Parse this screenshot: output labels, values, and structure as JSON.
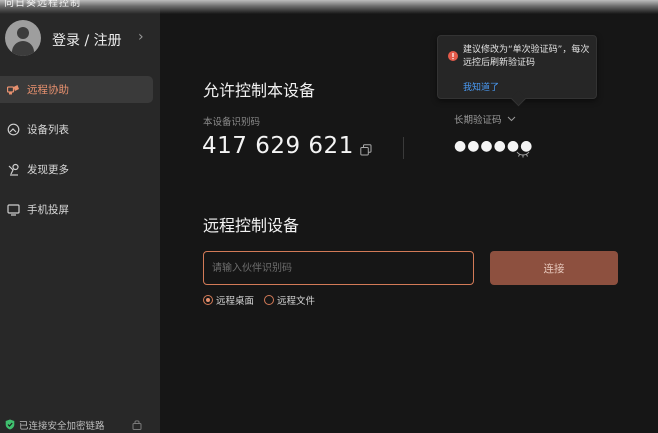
{
  "window": {
    "title": "向日葵远程控制"
  },
  "user": {
    "label": "登录 / 注册"
  },
  "sidebar": {
    "items": [
      {
        "label": "远程协助",
        "icon": "remote-assist-icon",
        "active": true
      },
      {
        "label": "设备列表",
        "icon": "device-list-icon",
        "active": false
      },
      {
        "label": "发现更多",
        "icon": "discover-icon",
        "active": false
      },
      {
        "label": "手机投屏",
        "icon": "screen-cast-icon",
        "active": false
      }
    ],
    "status": "已连接安全加密链路"
  },
  "allow": {
    "title": "允许控制本设备",
    "device_id_label": "本设备识别码",
    "device_id": "417 629 621",
    "code_type": "长期验证码",
    "code_mask": "●●●●●●"
  },
  "tooltip": {
    "text": "建议修改为“单次验证码”，每次远控后刷新验证码",
    "link": "我知道了"
  },
  "remote": {
    "title": "远程控制设备",
    "input_placeholder": "请输入伙伴识别码",
    "connect_label": "连接",
    "options": [
      {
        "label": "远程桌面",
        "checked": true
      },
      {
        "label": "远程文件",
        "checked": false
      }
    ]
  },
  "colors": {
    "accent": "#e8916f",
    "accent_border": "#d27a57",
    "connect_bg": "#8d503f",
    "sidebar_bg": "#282828",
    "main_bg": "#161616",
    "link": "#4a9bf5",
    "warning": "#e45a4a",
    "secure": "#3fbf6e"
  }
}
